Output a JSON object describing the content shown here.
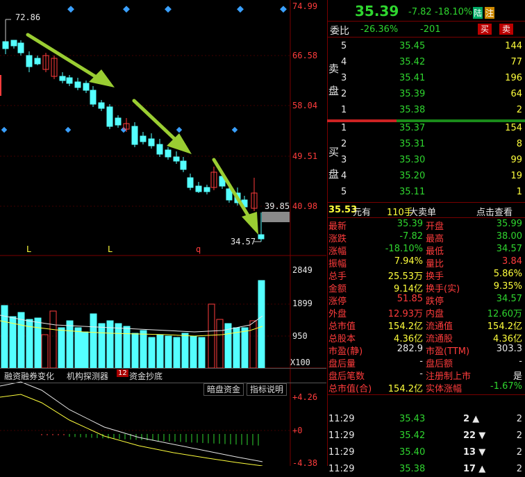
{
  "price_axis": [
    "74.99",
    "66.58",
    "58.04",
    "49.51",
    "40.98"
  ],
  "annotations": {
    "high": "72.86",
    "low": "34.57",
    "current_box": "39.85"
  },
  "markers": [
    "L",
    "L",
    "q"
  ],
  "volume_axis": [
    "2849",
    "1899",
    "950",
    "X100"
  ],
  "macd_axis": [
    "+4.26",
    "+0",
    "-4.38"
  ],
  "tabs": {
    "t1": "融资融券变化",
    "t2": "机构探测器",
    "t3_badge": "12",
    "t3": "资金抄底",
    "b1": "暗盘资金",
    "b2": "指标说明"
  },
  "header": {
    "price": "35.39",
    "change": "-7.82",
    "pct": "-18.10%",
    "tag1": "陆",
    "tag2": "注"
  },
  "weibi": {
    "label": "委比",
    "pct": "-26.36%",
    "diff": "-201",
    "buy": "买",
    "sell": "卖"
  },
  "sell_label": [
    "卖",
    "盘"
  ],
  "buy_label": [
    "买",
    "盘"
  ],
  "asks": [
    {
      "lvl": "5",
      "price": "35.45",
      "vol": "144"
    },
    {
      "lvl": "4",
      "price": "35.42",
      "vol": "77"
    },
    {
      "lvl": "3",
      "price": "35.41",
      "vol": "196"
    },
    {
      "lvl": "2",
      "price": "35.39",
      "vol": "64"
    },
    {
      "lvl": "1",
      "price": "35.38",
      "vol": "2"
    }
  ],
  "bids": [
    {
      "lvl": "1",
      "price": "35.37",
      "vol": "154"
    },
    {
      "lvl": "2",
      "price": "35.31",
      "vol": "8"
    },
    {
      "lvl": "3",
      "price": "35.30",
      "vol": "99"
    },
    {
      "lvl": "4",
      "price": "35.20",
      "vol": "19"
    },
    {
      "lvl": "5",
      "price": "35.11",
      "vol": "1"
    }
  ],
  "bigorder": {
    "price": "35.53",
    "unit": "元有",
    "vol": "110手",
    "label": "大卖单",
    "link": "点击查看"
  },
  "stats": [
    {
      "l1": "最新",
      "v1": "35.39",
      "c1": "green",
      "l2": "开盘",
      "v2": "35.99",
      "c2": "green"
    },
    {
      "l1": "涨跌",
      "v1": "-7.82",
      "c1": "green",
      "l2": "最高",
      "v2": "38.00",
      "c2": "green"
    },
    {
      "l1": "涨幅",
      "v1": "-18.10%",
      "c1": "green",
      "l2": "最低",
      "v2": "34.57",
      "c2": "green"
    },
    {
      "l1": "振幅",
      "v1": "7.94%",
      "c1": "yellow",
      "l2": "量比",
      "v2": "3.84",
      "c2": "red"
    },
    {
      "l1": "总手",
      "v1": "25.53万",
      "c1": "yellow",
      "l2": "换手",
      "v2": "5.86%",
      "c2": "yellow"
    },
    {
      "l1": "金额",
      "v1": "9.14亿",
      "c1": "yellow",
      "l2": "换手(实)",
      "v2": "9.35%",
      "c2": "yellow"
    },
    {
      "l1": "涨停",
      "v1": "51.85",
      "c1": "red",
      "l2": "跌停",
      "v2": "34.57",
      "c2": "green"
    },
    {
      "l1": "外盘",
      "v1": "12.93万",
      "c1": "red",
      "l2": "内盘",
      "v2": "12.60万",
      "c2": "green"
    },
    {
      "l1": "总市值",
      "v1": "154.2亿",
      "c1": "yellow",
      "l2": "流通值",
      "v2": "154.2亿",
      "c2": "yellow"
    },
    {
      "l1": "总股本",
      "v1": "4.36亿",
      "c1": "yellow",
      "l2": "流通股",
      "v2": "4.36亿",
      "c2": "yellow"
    },
    {
      "l1": "市盈(静)",
      "v1": "282.9",
      "c1": "white",
      "l2": "市盈(TTM)",
      "v2": "303.3",
      "c2": "white"
    },
    {
      "l1": "盘后量",
      "v1": "-",
      "c1": "white",
      "l2": "盘后额",
      "v2": "-",
      "c2": "white"
    },
    {
      "l1": "盘后笔数",
      "v1": "-",
      "c1": "white",
      "l2": "注册制上市",
      "v2": "是",
      "c2": "white"
    },
    {
      "l1": "总市值(合)",
      "v1": "154.2亿",
      "c1": "yellow",
      "l2": "实体涨幅",
      "v2": "-1.67%",
      "c2": "green"
    }
  ],
  "ticks": [
    {
      "time": "11:29",
      "price": "35.43",
      "vol": "2",
      "dir": "up",
      "cnt": "2"
    },
    {
      "time": "11:29",
      "price": "35.42",
      "vol": "22",
      "dir": "down",
      "cnt": "2"
    },
    {
      "time": "11:29",
      "price": "35.40",
      "vol": "13",
      "dir": "down",
      "cnt": "2"
    },
    {
      "time": "11:29",
      "price": "35.38",
      "vol": "17",
      "dir": "up",
      "cnt": "2"
    }
  ],
  "colors": {
    "up": "#ff3c3c",
    "down": "#54ffff",
    "arrow": "#9acd32"
  }
}
